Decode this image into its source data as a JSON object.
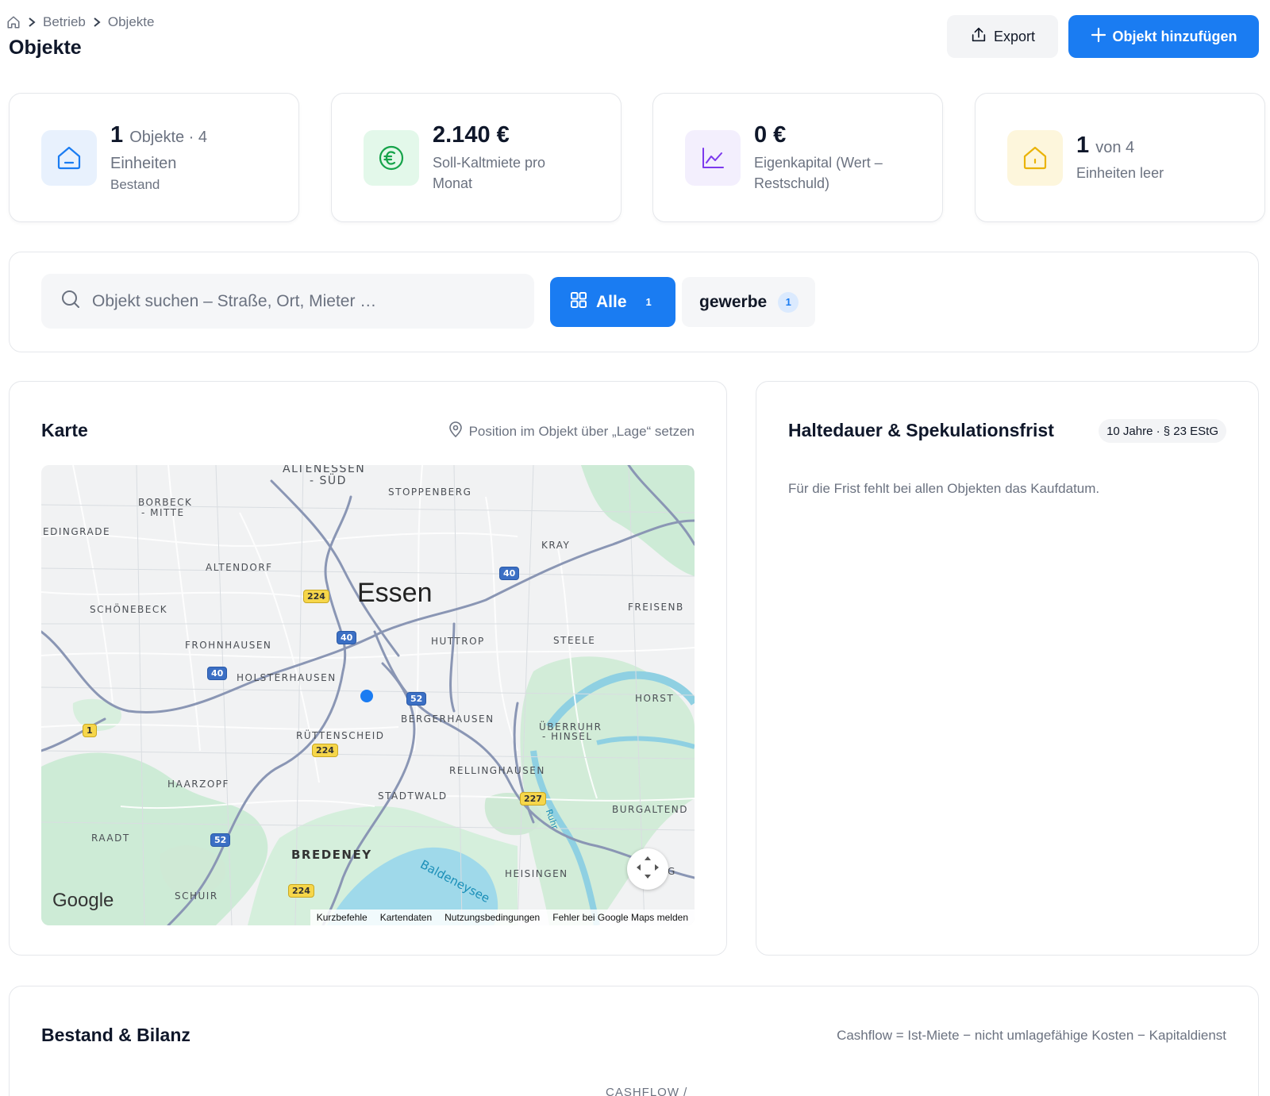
{
  "breadcrumb": {
    "items": [
      "Betrieb",
      "Objekte"
    ]
  },
  "page_title": "Objekte",
  "actions": {
    "export_label": "Export",
    "add_label": "Objekt hinzufügen"
  },
  "stats": [
    {
      "value": "1",
      "value_sub": "Objekte · 4",
      "label": "Einheiten",
      "label2": "Bestand"
    },
    {
      "value": "2.140 €",
      "label": "Soll-Kaltmiete pro",
      "label2": "Monat"
    },
    {
      "value": "0 €",
      "label": "Eigenkapital (Wert –",
      "label2": "Restschuld)"
    },
    {
      "value": "1",
      "value_sub": "von 4",
      "label": "Einheiten leer"
    }
  ],
  "filters": {
    "search_placeholder": "Objekt suchen – Straße, Ort, Mieter …",
    "chips": [
      {
        "label": "Alle",
        "count": "1",
        "active": true
      },
      {
        "label": "gewerbe",
        "count": "1",
        "active": false
      }
    ]
  },
  "map_card": {
    "title": "Karte",
    "hint": "Position im Objekt über „Lage“ setzen",
    "labels": {
      "altenessen": "ALTENESSEN",
      "sued": "- SÜD",
      "stoppenberg": "STOPPENBERG",
      "borbeck": "BORBECK",
      "mitte": "- MITTE",
      "edingrade": "EDINGRADE",
      "kray": "KRAY",
      "altendorf": "ALTENDORF",
      "essen": "Essen",
      "freisenb": "FREISENB",
      "schoenebeck": "SCHÖNEBECK",
      "huttrop": "HUTTROP",
      "steele": "STEELE",
      "frohnhausen": "FROHNHAUSEN",
      "holsterhausen": "HOLSTERHAUSEN",
      "horst": "HORST",
      "bergerhausen": "BERGERHAUSEN",
      "ueberruhr": "ÜBERRUHR",
      "hinsel": "- HINSEL",
      "ruettenscheid": "RÜTTENSCHEID",
      "rellinghausen": "RELLINGHAUSEN",
      "haarzopf": "HAARZOPF",
      "stadtwald": "STADTWALD",
      "burgaltend": "BURGALTEND",
      "raadt": "RAADT",
      "bredeney": "BREDENEY",
      "baldeneysee": "Baldeneysee",
      "heisingen": "HEISINGEN",
      "ruhr": "Ruhr",
      "schuir": "SCHUIR",
      "g": "G"
    },
    "shields": [
      "224",
      "40",
      "40",
      "40",
      "52",
      "1",
      "224",
      "227",
      "52",
      "224"
    ],
    "google": "Google",
    "attribution": [
      "Kurzbefehle",
      "Kartendaten",
      "Nutzungsbedingungen",
      "Fehler bei Google Maps melden"
    ]
  },
  "halte_card": {
    "title": "Haltedauer & Spekulationsfrist",
    "badge": "10 Jahre · § 23 EStG",
    "text": "Für die Frist fehlt bei allen Objekten das Kaufdatum."
  },
  "bilanz_card": {
    "title": "Bestand & Bilanz",
    "formula": "Cashflow = Ist-Miete − nicht umlagefähige Kosten − Kapitaldienst",
    "column_header": "CASHFLOW /"
  },
  "colors": {
    "accent": "#1a7cf2",
    "text_primary": "#0f172a",
    "text_muted": "#6b7280",
    "card_border": "#e5e7eb",
    "icon_blue_bg": "#e8f1fd",
    "icon_green_bg": "#e3f8ea",
    "icon_purple_bg": "#f3effd",
    "icon_yellow_bg": "#fdf6dc"
  },
  "icons": {
    "home": "home-icon",
    "chevron": "chevron-right-icon",
    "export": "share-icon",
    "plus": "plus-icon",
    "house": "house-icon",
    "euro": "euro-icon",
    "chart": "line-chart-icon",
    "search": "search-icon",
    "grid": "grid-icon",
    "pin": "map-pin-icon",
    "fullscreen": "fullscreen-icon"
  }
}
